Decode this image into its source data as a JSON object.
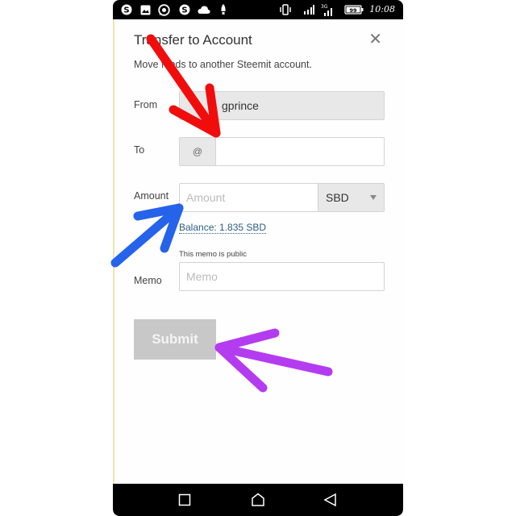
{
  "status_bar": {
    "time": "10:08",
    "battery": "99",
    "network": "3G",
    "icons": [
      "steemit-icon",
      "image-icon",
      "whatsapp-icon",
      "steemit-icon",
      "cloud-icon",
      "rocket-icon",
      "vibrate-icon",
      "signal-icon",
      "signal-3g-icon",
      "battery-icon"
    ]
  },
  "modal": {
    "title": "Transfer to Account",
    "subtitle": "Move funds to another Steemit account.",
    "close_icon": "✕",
    "from": {
      "label": "From",
      "prefix": "@",
      "value": "gprince"
    },
    "to": {
      "label": "To",
      "prefix": "@",
      "value": "",
      "placeholder": ""
    },
    "amount": {
      "label": "Amount",
      "placeholder": "Amount",
      "currency": "SBD",
      "balance": "Balance: 1.835 SBD"
    },
    "memo": {
      "label": "Memo",
      "note": "This memo is public",
      "placeholder": "Memo"
    },
    "submit_label": "Submit"
  },
  "annotations": {
    "arrow_colors": {
      "red": "#f20d0d",
      "blue": "#2563eb",
      "purple": "#b43cf0"
    }
  },
  "nav_bar": {
    "buttons": [
      "recent-apps",
      "home",
      "back"
    ]
  }
}
